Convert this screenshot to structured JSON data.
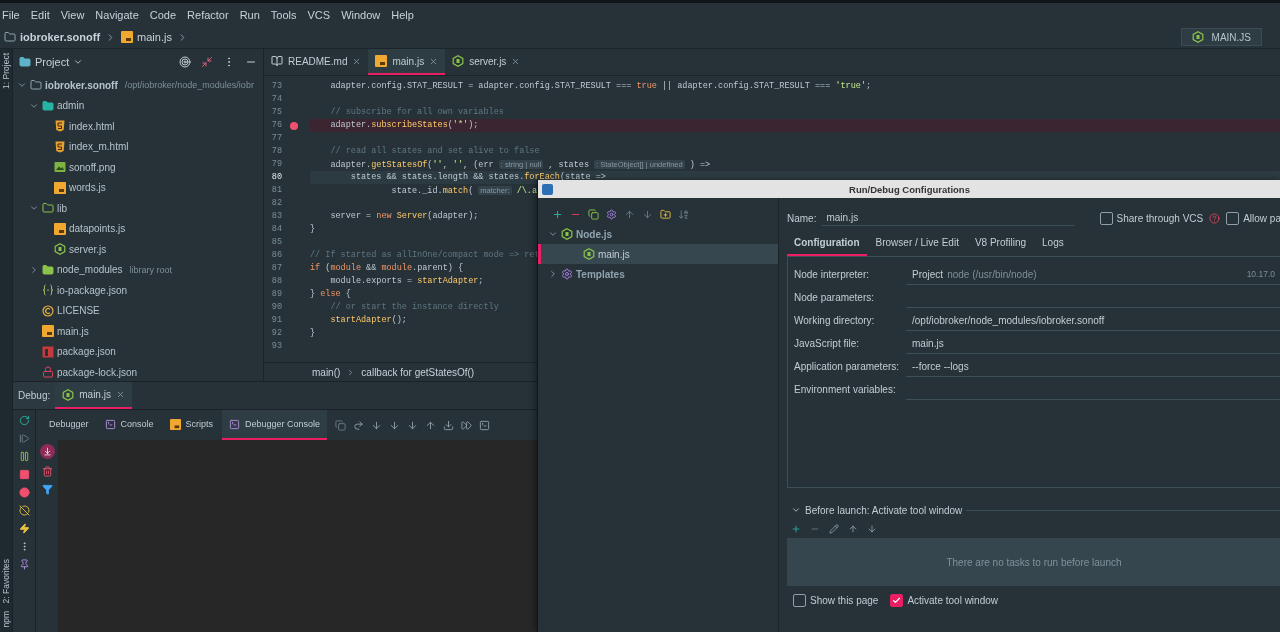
{
  "menu": [
    "File",
    "Edit",
    "View",
    "Navigate",
    "Code",
    "Refactor",
    "Run",
    "Tools",
    "VCS",
    "Window",
    "Help"
  ],
  "breadcrumb": [
    {
      "label": "iobroker.sonoff",
      "kind": "folder"
    },
    {
      "label": "main.js",
      "kind": "js"
    }
  ],
  "run_config": {
    "label": "MAIN.JS"
  },
  "side_stripe": {
    "top": [
      "1: Project"
    ],
    "bottom": [
      "2: Favorites",
      "npm"
    ]
  },
  "project_panel": {
    "title": "Project",
    "tree": [
      {
        "label": "iobroker.sonoff",
        "path": "/opt/iobroker/node_modules/iobr",
        "kind": "folder",
        "expanded": true,
        "children": [
          {
            "label": "admin",
            "kind": "web-folder",
            "expanded": true,
            "children": [
              {
                "label": "index.html",
                "kind": "html"
              },
              {
                "label": "index_m.html",
                "kind": "html"
              },
              {
                "label": "sonoff.png",
                "kind": "image"
              },
              {
                "label": "words.js",
                "kind": "js"
              }
            ]
          },
          {
            "label": "lib",
            "kind": "source-folder",
            "expanded": true,
            "children": [
              {
                "label": "datapoints.js",
                "kind": "js"
              },
              {
                "label": "server.js",
                "kind": "node"
              }
            ]
          },
          {
            "label": "node_modules",
            "note": "library root",
            "kind": "library-folder",
            "expanded": false
          },
          {
            "label": "io-package.json",
            "kind": "json"
          },
          {
            "label": "LICENSE",
            "kind": "license"
          },
          {
            "label": "main.js",
            "kind": "js"
          },
          {
            "label": "package.json",
            "kind": "npm"
          },
          {
            "label": "package-lock.json",
            "kind": "lock"
          }
        ]
      }
    ]
  },
  "editor": {
    "tabs": [
      {
        "label": "README.md",
        "kind": "readme",
        "selected": false
      },
      {
        "label": "main.js",
        "kind": "js",
        "selected": true
      },
      {
        "label": "server.js",
        "kind": "node",
        "selected": false
      }
    ],
    "lines": [
      {
        "num": "73",
        "breakpoint": false,
        "current": false,
        "tokens": [
          {
            "text": "    adapter.config.STAT_RESULT = adapter.config.STAT_RESULT === ",
            "kind": "plain"
          },
          {
            "text": "true",
            "kind": "keyword"
          },
          {
            "text": " || adapter.config.STAT_RESULT === ",
            "kind": "plain"
          },
          {
            "text": "'true'",
            "kind": "string"
          },
          {
            "text": ";",
            "kind": "plain"
          }
        ]
      },
      {
        "num": "74",
        "breakpoint": false,
        "current": false
      },
      {
        "num": "75",
        "breakpoint": false,
        "current": false,
        "tokens": [
          {
            "text": "    // subscribe for all own variables",
            "kind": "comment"
          }
        ]
      },
      {
        "num": "76",
        "breakpoint": true,
        "current": false,
        "tokens": [
          {
            "text": "    adapter.",
            "kind": "plain"
          },
          {
            "text": "subscribeStates",
            "kind": "method"
          },
          {
            "text": "(",
            "kind": "plain"
          },
          {
            "text": "'*'",
            "kind": "string"
          },
          {
            "text": ");",
            "kind": "plain"
          }
        ]
      },
      {
        "num": "77",
        "breakpoint": false,
        "current": false
      },
      {
        "num": "78",
        "breakpoint": false,
        "current": false,
        "tokens": [
          {
            "text": "    // read all states and set alive to false",
            "kind": "comment"
          }
        ]
      },
      {
        "num": "79",
        "breakpoint": false,
        "current": false,
        "tokens": [
          {
            "text": "    adapter.",
            "kind": "plain"
          },
          {
            "text": "getStatesOf",
            "kind": "method"
          },
          {
            "text": "(",
            "kind": "plain"
          },
          {
            "text": "''",
            "kind": "string"
          },
          {
            "text": ", ",
            "kind": "plain"
          },
          {
            "text": "''",
            "kind": "string"
          },
          {
            "text": ", (err ",
            "kind": "plain"
          },
          {
            "text": ": string | null",
            "kind": "hint"
          },
          {
            "text": " , states ",
            "kind": "plain"
          },
          {
            "text": ": StateObject[] | undefined",
            "kind": "hint"
          },
          {
            "text": " ) =>",
            "kind": "plain"
          }
        ]
      },
      {
        "num": "80",
        "breakpoint": false,
        "current": true,
        "tokens": [
          {
            "text": "        states && states.length && states.",
            "kind": "plain"
          },
          {
            "text": "forEach",
            "kind": "method"
          },
          {
            "text": "(state =>",
            "kind": "plain"
          }
        ]
      },
      {
        "num": "81",
        "breakpoint": false,
        "current": false,
        "tokens": [
          {
            "text": "                state._id.",
            "kind": "plain"
          },
          {
            "text": "match",
            "kind": "method"
          },
          {
            "text": "( ",
            "kind": "plain"
          },
          {
            "text": "matcher:",
            "kind": "hint"
          },
          {
            "text": " /\\.a",
            "kind": "string"
          }
        ]
      },
      {
        "num": "82",
        "breakpoint": false,
        "current": false
      },
      {
        "num": "83",
        "breakpoint": false,
        "current": false,
        "tokens": [
          {
            "text": "    server = ",
            "kind": "plain"
          },
          {
            "text": "new",
            "kind": "keyword"
          },
          {
            "text": " Server",
            "kind": "method"
          },
          {
            "text": "(adapter);",
            "kind": "plain"
          }
        ]
      },
      {
        "num": "84",
        "breakpoint": false,
        "current": false,
        "tokens": [
          {
            "text": "}",
            "kind": "plain"
          }
        ]
      },
      {
        "num": "85",
        "breakpoint": false,
        "current": false
      },
      {
        "num": "86",
        "breakpoint": false,
        "current": false,
        "tokens": [
          {
            "text": "// If started as allInOne/compact mode => ret",
            "kind": "comment"
          }
        ]
      },
      {
        "num": "87",
        "breakpoint": false,
        "current": false,
        "tokens": [
          {
            "text": "if",
            "kind": "keyword"
          },
          {
            "text": " (",
            "kind": "plain"
          },
          {
            "text": "module",
            "kind": "keyword"
          },
          {
            "text": " && ",
            "kind": "plain"
          },
          {
            "text": "module",
            "kind": "keyword"
          },
          {
            "text": ".parent) {",
            "kind": "plain"
          }
        ]
      },
      {
        "num": "88",
        "breakpoint": false,
        "current": false,
        "tokens": [
          {
            "text": "    module.exports = ",
            "kind": "plain"
          },
          {
            "text": "startAdapter",
            "kind": "method"
          },
          {
            "text": ";",
            "kind": "plain"
          }
        ]
      },
      {
        "num": "89",
        "breakpoint": false,
        "current": false,
        "tokens": [
          {
            "text": "} ",
            "kind": "plain"
          },
          {
            "text": "else",
            "kind": "keyword"
          },
          {
            "text": " {",
            "kind": "plain"
          }
        ]
      },
      {
        "num": "90",
        "breakpoint": false,
        "current": false,
        "tokens": [
          {
            "text": "    // or start the instance directly",
            "kind": "comment"
          }
        ]
      },
      {
        "num": "91",
        "breakpoint": false,
        "current": false,
        "tokens": [
          {
            "text": "    startAdapter",
            "kind": "method"
          },
          {
            "text": "();",
            "kind": "plain"
          }
        ]
      },
      {
        "num": "92",
        "breakpoint": false,
        "current": false,
        "tokens": [
          {
            "text": "}",
            "kind": "plain"
          }
        ]
      },
      {
        "num": "93",
        "breakpoint": false,
        "current": false
      }
    ],
    "breadcrumb": [
      "main()",
      "callback for getStatesOf()"
    ]
  },
  "debug": {
    "label": "Debug:",
    "sessions": [
      {
        "label": "main.js",
        "selected": true
      }
    ],
    "tabs": [
      {
        "label": "Debugger",
        "kind": "plain",
        "selected": false
      },
      {
        "label": "Console",
        "kind": "console",
        "selected": false
      },
      {
        "label": "Scripts",
        "kind": "js",
        "selected": false
      },
      {
        "label": "Debugger Console",
        "kind": "console",
        "selected": true
      }
    ]
  },
  "dialog": {
    "title": "Run/Debug Configurations",
    "tree": [
      {
        "label": "Node.js",
        "kind": "node",
        "expanded": true,
        "selected": false,
        "children": [
          {
            "label": "main.js",
            "kind": "node",
            "selected": true
          }
        ]
      },
      {
        "label": "Templates",
        "kind": "gear",
        "expanded": false,
        "selected": false
      }
    ],
    "name_label": "Name:",
    "name": "main.js",
    "options": [
      {
        "label": "Share through VCS",
        "checked": false,
        "help": true
      },
      {
        "label": "Allow pa",
        "checked": false,
        "help": false
      }
    ],
    "tabs": [
      {
        "label": "Configuration",
        "selected": true
      },
      {
        "label": "Browser / Live Edit",
        "selected": false
      },
      {
        "label": "V8 Profiling",
        "selected": false
      },
      {
        "label": "Logs",
        "selected": false
      }
    ],
    "fields": [
      {
        "label": "Node interpreter:",
        "value": "Project",
        "hint": "node (/usr/bin/node)",
        "version": "10.17.0"
      },
      {
        "label": "Node parameters:"
      },
      {
        "label": "Working directory:",
        "value": "/opt/iobroker/node_modules/iobroker.sonoff"
      },
      {
        "label": "JavaScript file:",
        "value": "main.js"
      },
      {
        "label": "Application parameters:",
        "value": "--force --logs"
      },
      {
        "label": "Environment variables:"
      }
    ],
    "before_launch": {
      "title": "Before launch: Activate tool window",
      "expanded": true,
      "empty_text": "There are no tasks to run before launch"
    },
    "checks": [
      {
        "label": "Show this page",
        "checked": false
      },
      {
        "label": "Activate tool window",
        "checked": true
      }
    ]
  }
}
